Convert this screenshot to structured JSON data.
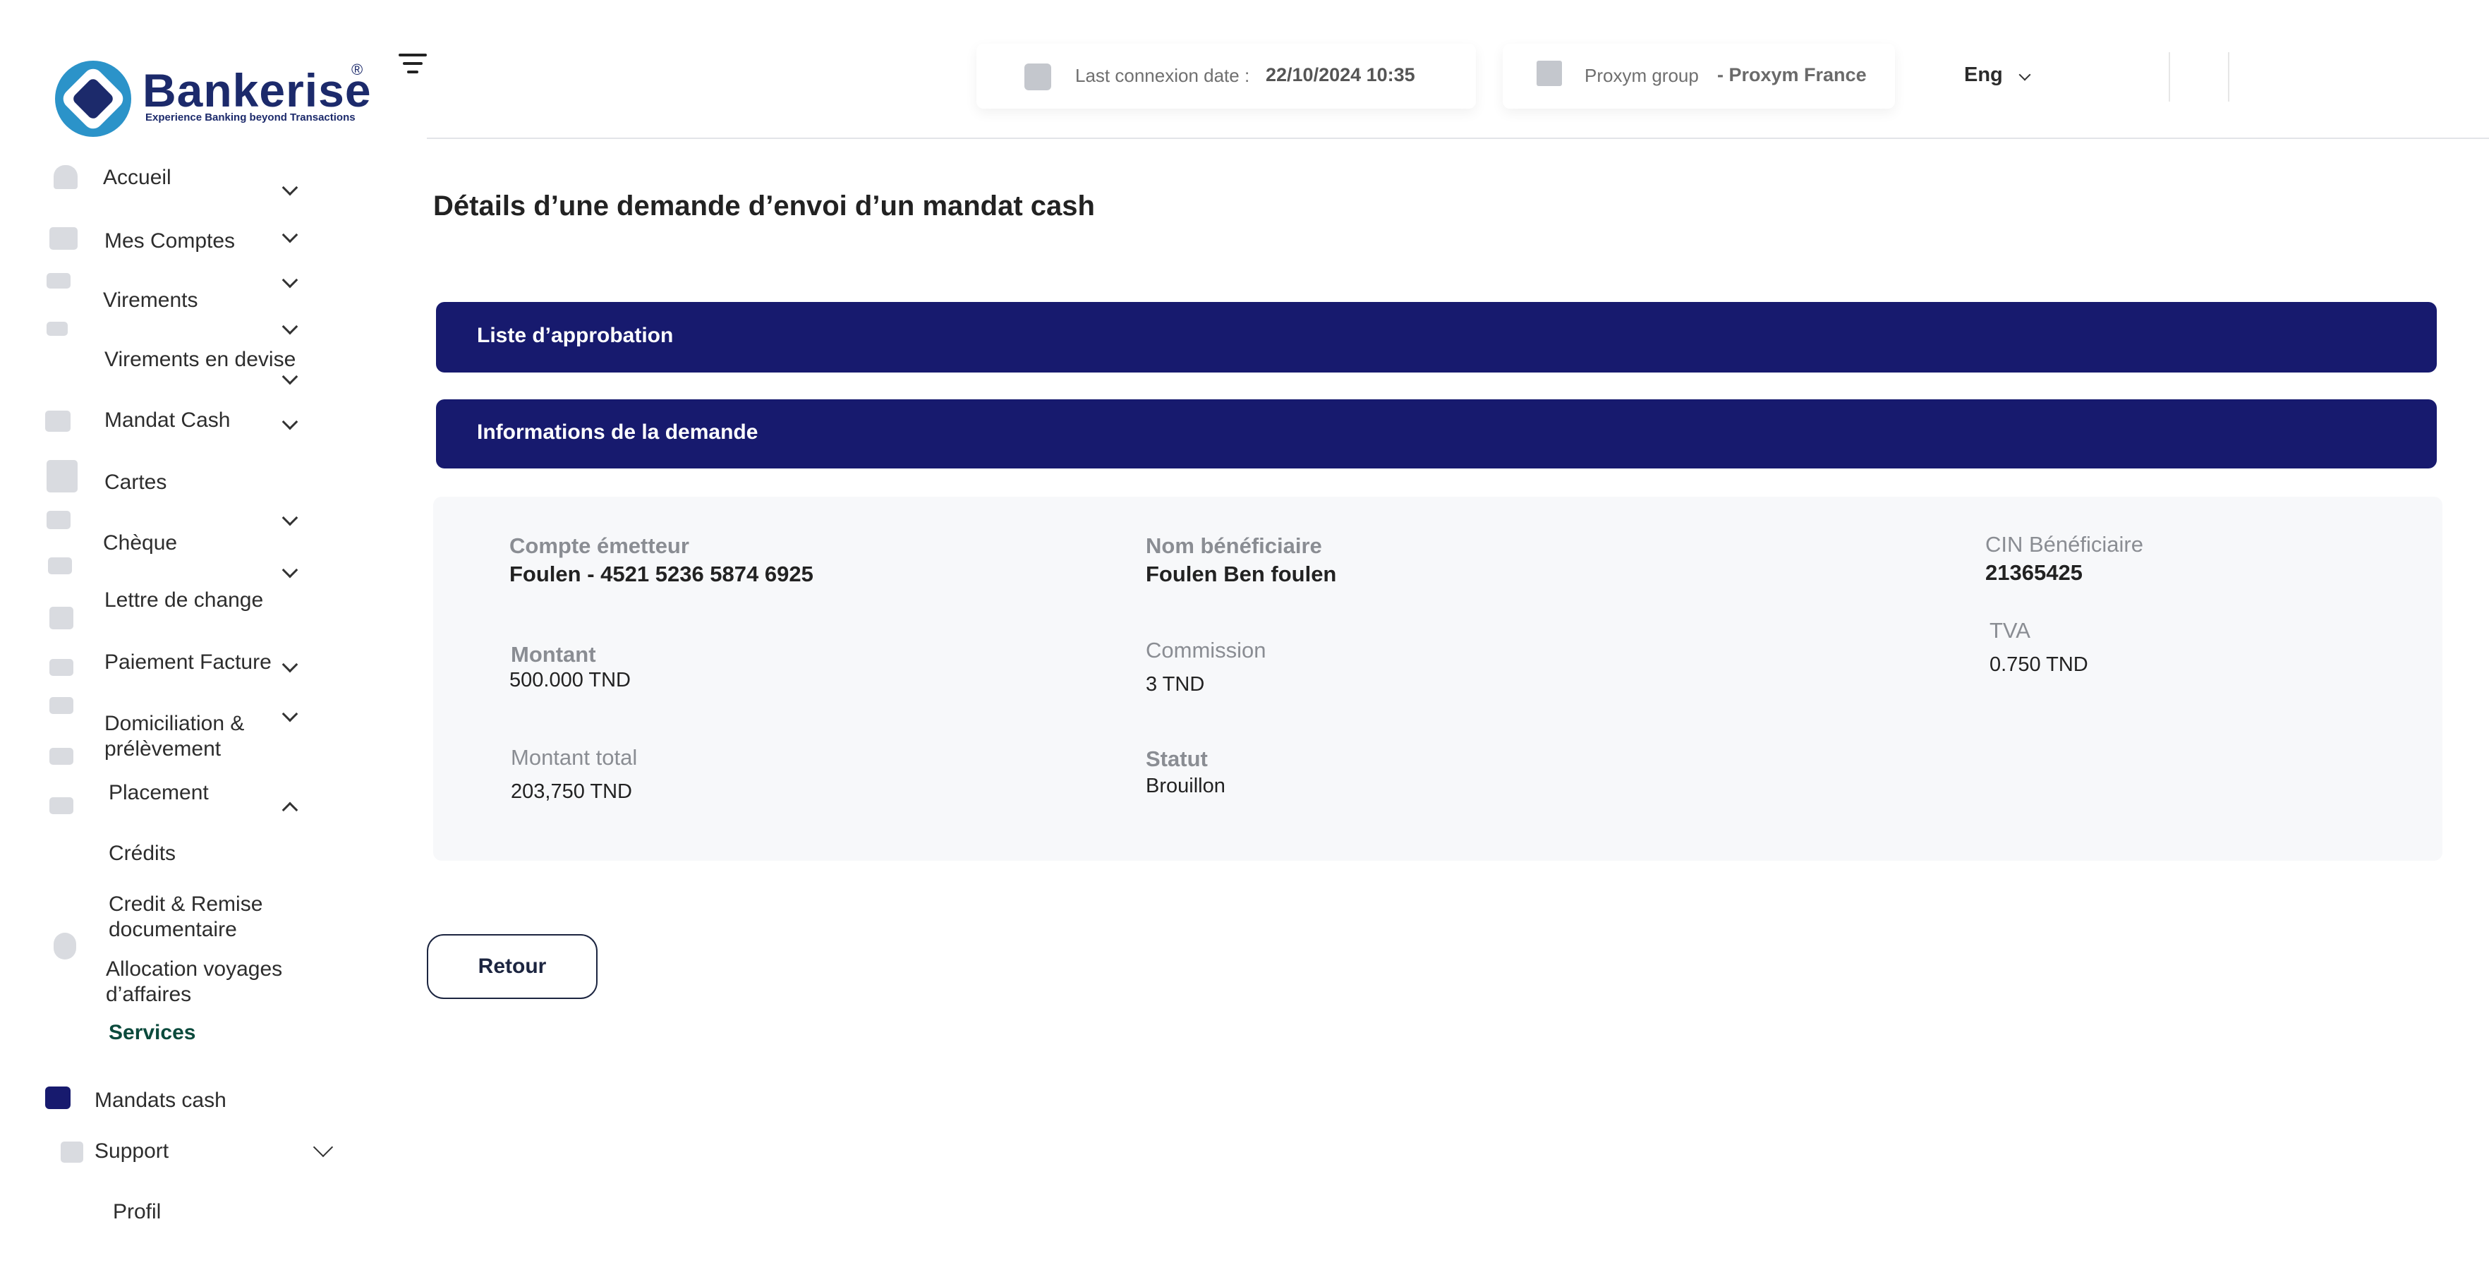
{
  "brand": {
    "name": "Bankerise",
    "registered": "®",
    "tagline": "Experience Banking beyond Transactions"
  },
  "header": {
    "last_connexion_label": "Last connexion date :",
    "last_connexion_value": "22/10/2024 10:35",
    "company_group": "Proxym group",
    "company_name": "- Proxym France",
    "language": "Eng"
  },
  "sidebar": {
    "items": [
      {
        "label": "Accueil"
      },
      {
        "label": "Mes Comptes"
      },
      {
        "label": "Virements"
      },
      {
        "label": "Virements en devise"
      },
      {
        "label": "Mandat Cash"
      },
      {
        "label": "Cartes"
      },
      {
        "label": "Chèque"
      },
      {
        "label": "Lettre de change"
      },
      {
        "label": "Paiement Facture"
      },
      {
        "label": "Domiciliation & prélèvement"
      },
      {
        "label": "Placement"
      }
    ],
    "sub_items": [
      {
        "label": "Crédits"
      },
      {
        "label": "Credit & Remise documentaire"
      },
      {
        "label": "Allocation  voyages d’affaires"
      },
      {
        "label": "Services"
      }
    ],
    "bottom_items": [
      {
        "label": "Mandats cash"
      },
      {
        "label": "Support"
      },
      {
        "label": "Profil"
      }
    ]
  },
  "page": {
    "title": "Détails d’une demande d’envoi d’un mandat cash",
    "sections": [
      {
        "label": "Liste d’approbation"
      },
      {
        "label": "Informations de la demande"
      }
    ],
    "fields": {
      "compte_emetteur": {
        "label": "Compte émetteur",
        "value": "Foulen - 4521 5236 5874 6925"
      },
      "nom_beneficiaire": {
        "label": "Nom bénéficiaire",
        "value": "Foulen Ben foulen"
      },
      "cin_beneficiaire": {
        "label": "CIN Bénéficiaire",
        "value": "21365425"
      },
      "montant": {
        "label": "Montant",
        "value": "500.000 TND"
      },
      "commission": {
        "label": "Commission",
        "value": "3 TND"
      },
      "tva": {
        "label": "TVA",
        "value": "0.750 TND"
      },
      "montant_total": {
        "label": "Montant total",
        "value": "203,750  TND"
      },
      "statut": {
        "label": "Statut",
        "value": "Brouillon"
      }
    },
    "retour_button": "Retour"
  },
  "colors": {
    "primary": "#171a6e",
    "brand_blue": "#2b93c9",
    "panel_bg": "#f7f8fa",
    "active_text": "#0b4a3c"
  }
}
